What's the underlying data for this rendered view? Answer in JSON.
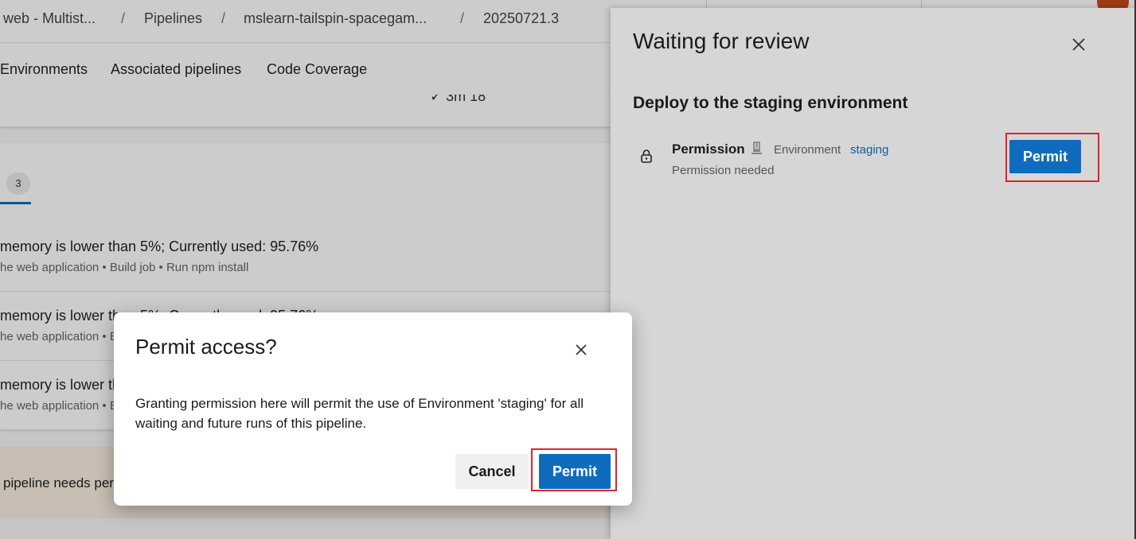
{
  "breadcrumb": {
    "items": [
      "web - Multist...",
      "mslearn-tailspin-spacegam...",
      "20250721.3"
    ],
    "pipelines": "Pipelines",
    "separator": "/"
  },
  "tabs": [
    "Environments",
    "Associated pipelines",
    "Code Coverage"
  ],
  "summary_strip_text": "✓ 3m 18",
  "issues": {
    "count": "3",
    "rows": [
      {
        "title": "memory is lower than 5%; Currently used: 95.76%",
        "sub": "he web application • Build job • Run npm install"
      },
      {
        "title": "memory is lower than 5%; Currently used: 95.76%",
        "sub": "he web application • Build job • Run npm install"
      },
      {
        "title": "memory is lower than 5%; Currently used: 95.76%",
        "sub": "he web application • Build job • Run npm install"
      }
    ]
  },
  "notice": "pipeline needs permission",
  "panel": {
    "title": "Waiting for review",
    "stage_title": "Deploy to the staging environment",
    "check": {
      "name": "Permission",
      "resource_type": "Environment",
      "resource_name": "staging",
      "status": "Permission needed",
      "action_label": "Permit"
    }
  },
  "dialog": {
    "title": "Permit access?",
    "body": "Granting permission here will permit the use of Environment 'staging' for all waiting and future runs of this pipeline.",
    "cancel_label": "Cancel",
    "permit_label": "Permit"
  },
  "colors": {
    "primary": "#0f6cbd",
    "highlight": "#e0242b",
    "link": "#0f5d9e"
  },
  "icons": [
    "close-icon",
    "lock-icon",
    "environment-icon"
  ]
}
